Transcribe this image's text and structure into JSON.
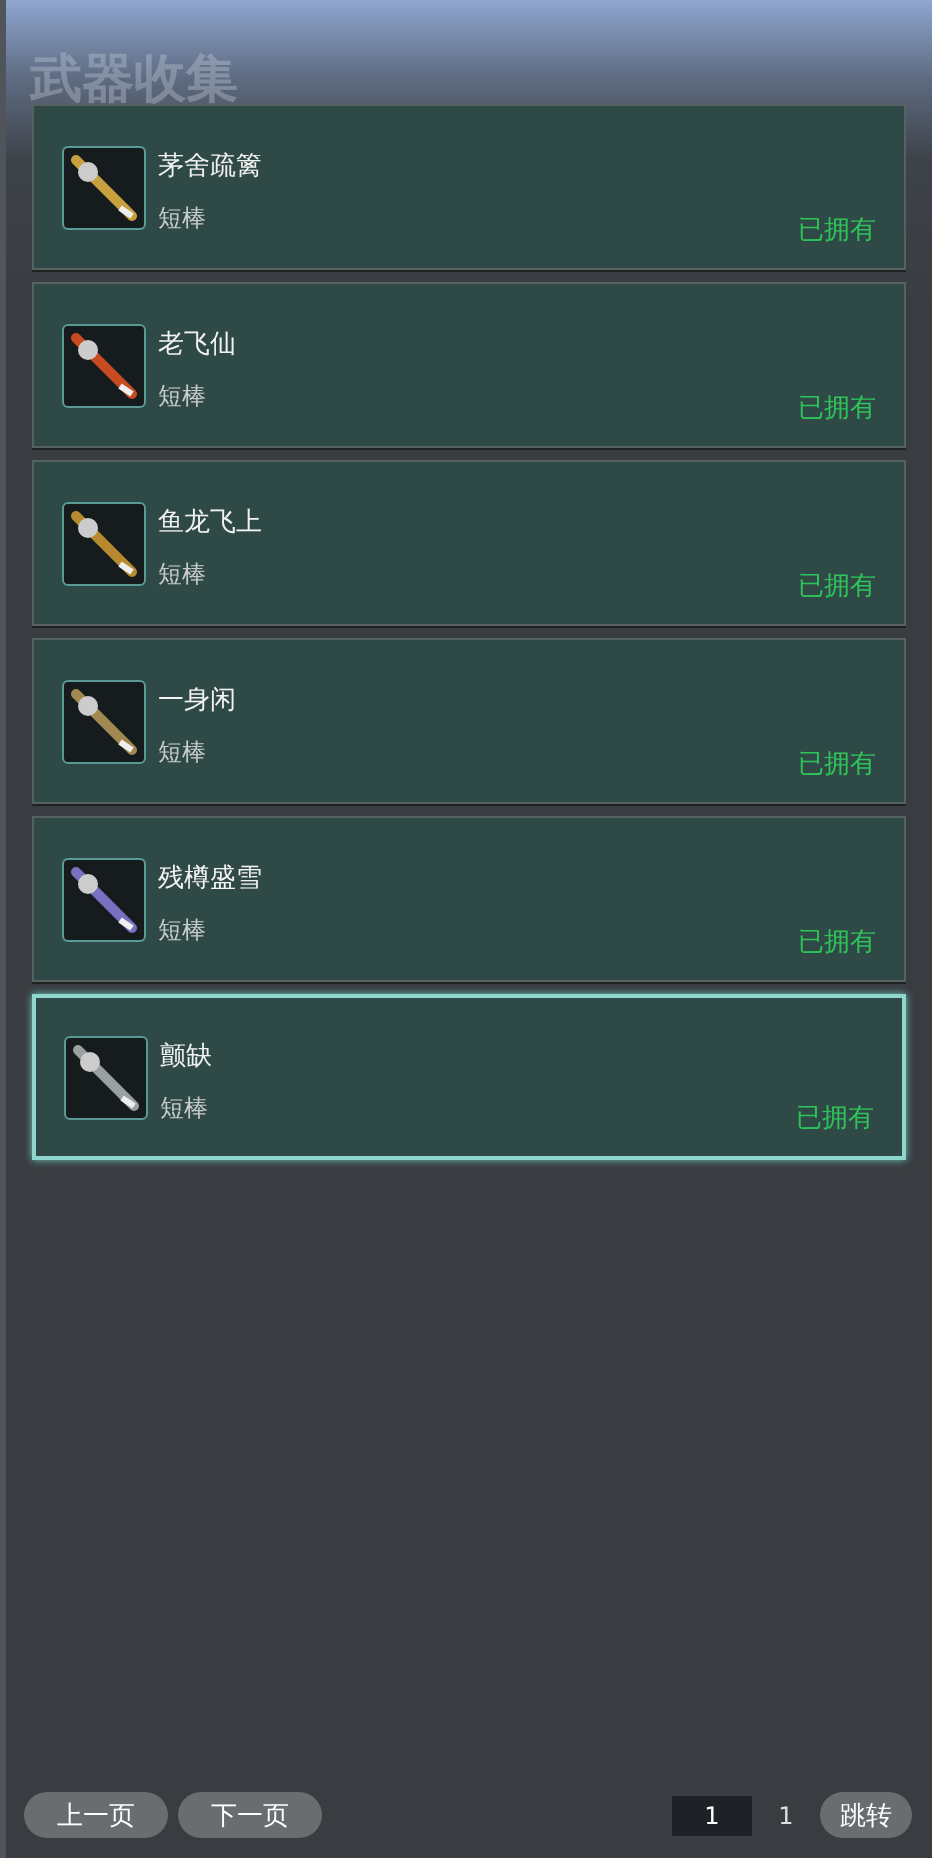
{
  "title": "武器收集",
  "weapons": [
    {
      "name": "茅舍疏篱",
      "type": "短棒",
      "status": "已拥有",
      "selected": false
    },
    {
      "name": "老飞仙",
      "type": "短棒",
      "status": "已拥有",
      "selected": false
    },
    {
      "name": "鱼龙飞上",
      "type": "短棒",
      "status": "已拥有",
      "selected": false
    },
    {
      "name": "一身闲",
      "type": "短棒",
      "status": "已拥有",
      "selected": false
    },
    {
      "name": "残樽盛雪",
      "type": "短棒",
      "status": "已拥有",
      "selected": false
    },
    {
      "name": "颤缺",
      "type": "短棒",
      "status": "已拥有",
      "selected": true
    }
  ],
  "pager": {
    "prev": "上一页",
    "next": "下一页",
    "page": "1",
    "total": "1",
    "jump": "跳转"
  }
}
